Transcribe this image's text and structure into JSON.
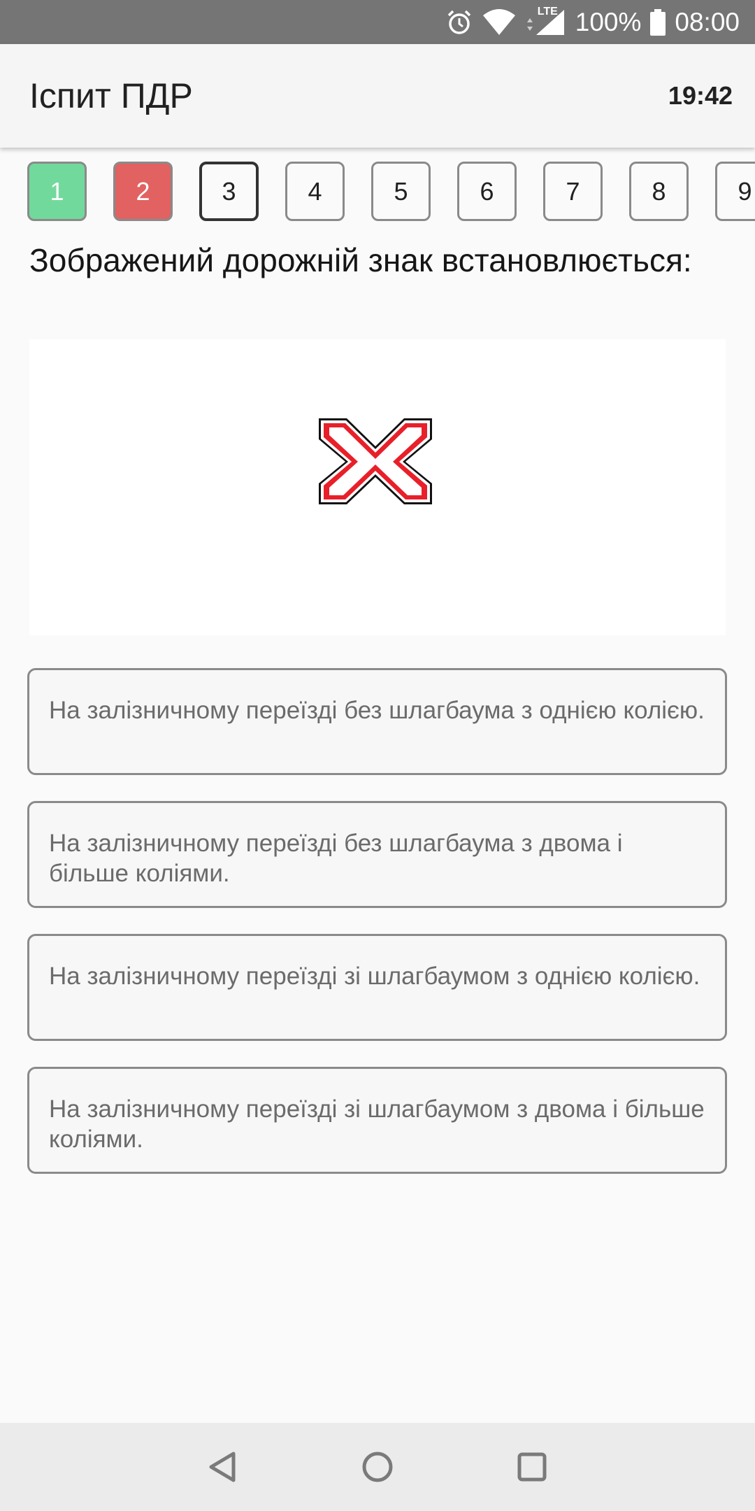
{
  "status_bar": {
    "network": "LTE",
    "battery": "100%",
    "time": "08:00",
    "icons": [
      "alarm-icon",
      "wifi-icon",
      "signal-icon",
      "battery-icon"
    ]
  },
  "header": {
    "title": "Іспит ПДР",
    "timer": "19:42"
  },
  "questions_nav": {
    "items": [
      {
        "label": "1",
        "state": "correct"
      },
      {
        "label": "2",
        "state": "wrong"
      },
      {
        "label": "3",
        "state": "current"
      },
      {
        "label": "4",
        "state": "unanswered"
      },
      {
        "label": "5",
        "state": "unanswered"
      },
      {
        "label": "6",
        "state": "unanswered"
      },
      {
        "label": "7",
        "state": "unanswered"
      },
      {
        "label": "8",
        "state": "unanswered"
      },
      {
        "label": "9",
        "state": "unanswered"
      }
    ]
  },
  "question": {
    "text": "Зображений дорожній знак встановлюється:",
    "image": "railway-crossing-multi-track-sign"
  },
  "answers": [
    {
      "text": "На залізничному переїзді без шлагбаума з однією колією."
    },
    {
      "text": "На залізничному переїзді без шлагбаума з двома і більше коліями."
    },
    {
      "text": "На залізничному переїзді зі шлагбаумом з однією колією."
    },
    {
      "text": "На залізничному переїзді зі шлагбаумом з двома і більше коліями."
    }
  ],
  "nav_bar": {
    "buttons": [
      "back-icon",
      "home-icon",
      "recents-icon"
    ]
  },
  "colors": {
    "correct": "#72d99c",
    "wrong": "#e26161",
    "status_bar": "#757575",
    "sign_red": "#e8202a"
  }
}
